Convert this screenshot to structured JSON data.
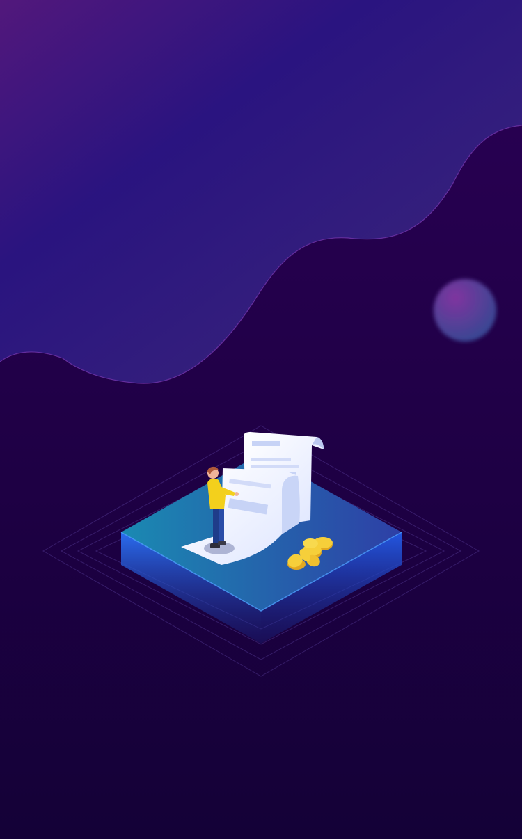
{
  "scene": {
    "subject": "isometric-platform-with-receipt-figure-and-coins",
    "colors": {
      "background_top": "#24004d",
      "background_bottom": "#150138",
      "wave_highlight": "#7f2fb0",
      "wave_light": "#3a2b8c",
      "platform_top_left": "#1a8fb6",
      "platform_top_right": "#2f4fae",
      "platform_side": "#1d56e6",
      "paper": "#f1f3ff",
      "paper_lines": "#c7d3f6",
      "coin": "#f6cf3a",
      "figure_shirt": "#f3d01c",
      "figure_pants": "#1f3c8a",
      "orb": "#6a4aa3"
    }
  }
}
